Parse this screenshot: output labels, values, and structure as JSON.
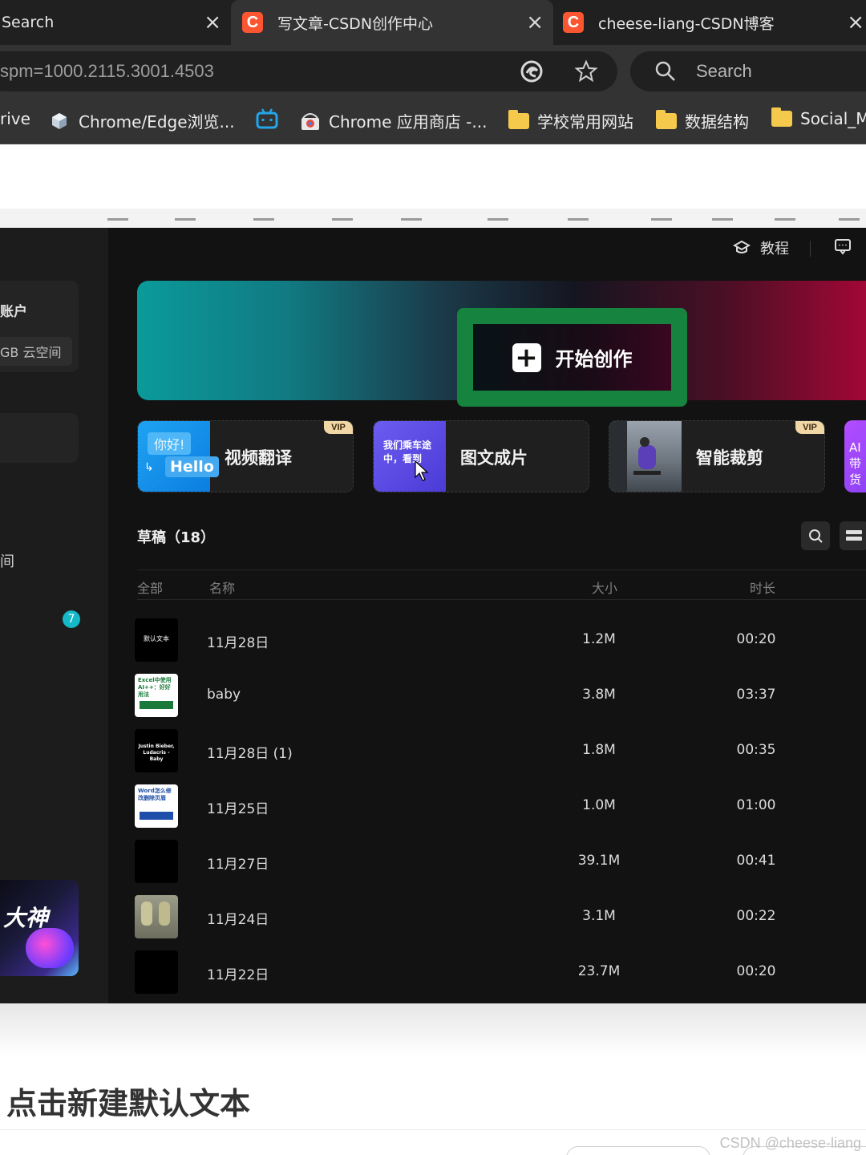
{
  "browser": {
    "tabs": [
      {
        "title": "Search",
        "active": false
      },
      {
        "title": "写文章-CSDN创作中心",
        "active": true
      },
      {
        "title": "cheese-liang-CSDN博客",
        "active": false
      }
    ],
    "tab_close_glyph": "×",
    "favicon_letter": "C",
    "address": "spm=1000.2115.3001.4503",
    "search_placeholder": "Search",
    "bookmarks": [
      {
        "label": "rive",
        "icon": "none"
      },
      {
        "label": "Chrome/Edge浏览...",
        "icon": "cube-icon"
      },
      {
        "label": "",
        "icon": "bilibili-icon"
      },
      {
        "label": "Chrome 应用商店 -...",
        "icon": "webstore-icon"
      },
      {
        "label": "学校常用网站",
        "icon": "folder-icon"
      },
      {
        "label": "数据结构",
        "icon": "folder-icon"
      },
      {
        "label": "Social_Me",
        "icon": "folder-icon"
      }
    ]
  },
  "app": {
    "tutorial_label": "教程",
    "sidebar": {
      "account_label": "账户",
      "cloud_label": "GB 云空间",
      "partial_text": "间",
      "badge_count": "7",
      "promo_text": "大神"
    },
    "create_button": "开始创作",
    "plus_glyph": "+",
    "vip_label": "VIP",
    "features": [
      {
        "name": "视频翻译",
        "vip": true,
        "thumb_text_top": "你好!",
        "thumb_text_bottom": "Hello"
      },
      {
        "name": "图文成片",
        "vip": false,
        "thumb_text_top": "我们乘车途中，看到"
      },
      {
        "name": "智能裁剪",
        "vip": true
      },
      {
        "name": "AI带货",
        "vip": false
      }
    ],
    "drafts_title": "草稿（18）",
    "table": {
      "headers": [
        "全部",
        "名称",
        "大小",
        "时长"
      ],
      "rows": [
        {
          "name": "11月28日",
          "size": "1.2M",
          "duration": "00:20",
          "thumb_text": "默认文本",
          "thumb_bg": "#000000"
        },
        {
          "name": "baby",
          "size": "3.8M",
          "duration": "03:37",
          "thumb_text": "Excel中使用AI++：好好用法",
          "thumb_bg": "#ffffff"
        },
        {
          "name": "11月28日 (1)",
          "size": "1.8M",
          "duration": "00:35",
          "thumb_text": "Justin Bieber, Ludacris - Baby",
          "thumb_bg": "#000000"
        },
        {
          "name": "11月25日",
          "size": "1.0M",
          "duration": "01:00",
          "thumb_text": "Word怎么修改删除页眉",
          "thumb_bg": "#ffffff"
        },
        {
          "name": "11月27日",
          "size": "39.1M",
          "duration": "00:41",
          "thumb_text": "",
          "thumb_bg": "#000000"
        },
        {
          "name": "11月24日",
          "size": "3.1M",
          "duration": "00:22",
          "thumb_text": "",
          "thumb_bg": "#8a8a7a"
        },
        {
          "name": "11月22日",
          "size": "23.7M",
          "duration": "00:20",
          "thumb_text": "",
          "thumb_bg": "#000000"
        }
      ]
    }
  },
  "page": {
    "heading": "点击新建默认文本",
    "watermark": "CSDN @cheese-liang"
  },
  "colors": {
    "csdn_brand": "#fc5531",
    "create_highlight": "#16843f",
    "badge": "#14b8c8",
    "vip": "#f1d7a6"
  }
}
